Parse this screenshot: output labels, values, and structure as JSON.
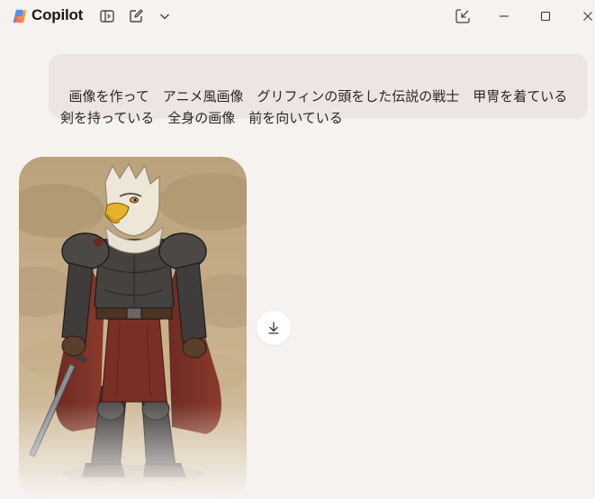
{
  "app": {
    "title": "Copilot",
    "brand_colors": [
      "#f25a4b",
      "#f9b233",
      "#3aa5f5",
      "#7b6cf6"
    ]
  },
  "toolbar": {
    "icons": [
      "sidebar-toggle-icon",
      "new-chat-icon",
      "chevron-down-icon"
    ]
  },
  "window_controls": {
    "icons": [
      "pop-out-icon",
      "minimize-icon",
      "maximize-icon",
      "close-icon"
    ]
  },
  "conversation": {
    "user_prompt": "画像を作って　アニメ風画像　グリフィンの頭をした伝説の戦士　甲冑を着ている　剣を持っている　全身の画像　前を向いている",
    "generated_image": {
      "type": "illustration",
      "actions": [
        "download-icon"
      ]
    }
  }
}
